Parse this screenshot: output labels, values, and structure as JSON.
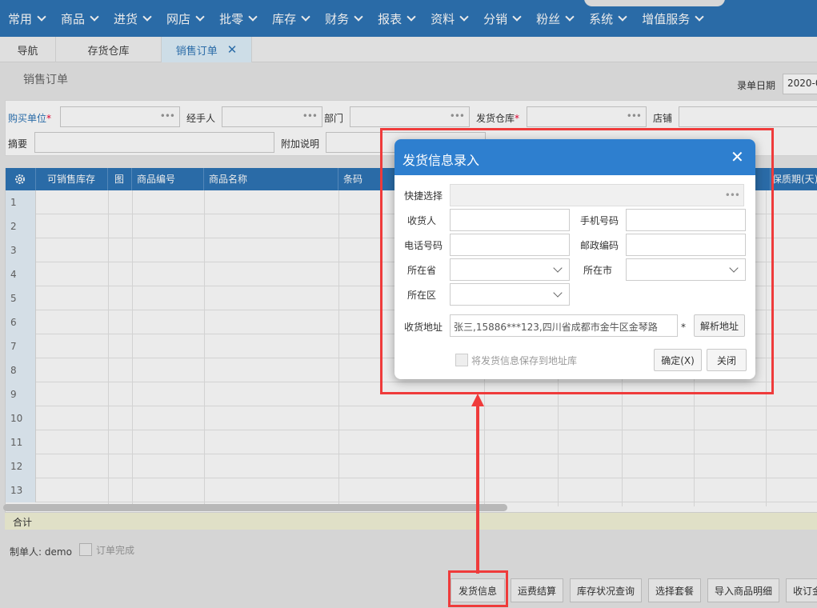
{
  "topnav": {
    "items": [
      "常用",
      "商品",
      "进货",
      "网店",
      "批零",
      "库存",
      "财务",
      "报表",
      "资料",
      "分销",
      "粉丝",
      "系统",
      "增值服务"
    ]
  },
  "tabs": [
    {
      "label": "导航"
    },
    {
      "label": "存货仓库"
    },
    {
      "label": "销售订单",
      "close": "✕"
    }
  ],
  "page": {
    "title": "销售订单",
    "date_label": "录单日期",
    "date_value": "2020-0",
    "form": {
      "buyer_label": "购买单位",
      "handler_label": "经手人",
      "dept_label": "部门",
      "warehouse_label": "发货仓库",
      "shop_label": "店铺",
      "summary_label": "摘要",
      "note_label": "附加说明",
      "required_mark": "*",
      "dots": "•••"
    },
    "grid": {
      "columns": [
        "可销售库存",
        "图",
        "商品编号",
        "商品名称",
        "条码",
        "保质期(天)"
      ],
      "rows": [
        "1",
        "2",
        "3",
        "4",
        "5",
        "6",
        "7",
        "8",
        "9",
        "10",
        "11",
        "12",
        "13"
      ],
      "total_label": "合计"
    },
    "maker_label": "制单人:",
    "maker_value": "demo",
    "order_done_label": "订单完成",
    "buttons": {
      "ship_info": "发货信息",
      "freight": "运费结算",
      "stock_query": "库存状况查询",
      "select_package": "选择套餐",
      "import_goods": "导入商品明细",
      "receipt": "收订金"
    }
  },
  "modal": {
    "title": "发货信息录入",
    "close": "✕",
    "quick_label": "快捷选择",
    "receiver_label": "收货人",
    "mobile_label": "手机号码",
    "phone_label": "电话号码",
    "zip_label": "邮政编码",
    "province_label": "所在省",
    "city_label": "所在市",
    "district_label": "所在区",
    "address_label": "收货地址",
    "address_value": "张三,15886***123,四川省成都市金牛区金琴路",
    "parse_button": "解析地址",
    "save_checkbox_label": "将发货信息保存到地址库",
    "ok_button": "确定(X)",
    "close_button": "关闭"
  },
  "colors": {
    "nav": "#2e75b6",
    "annotation": "#ef3b3b"
  }
}
